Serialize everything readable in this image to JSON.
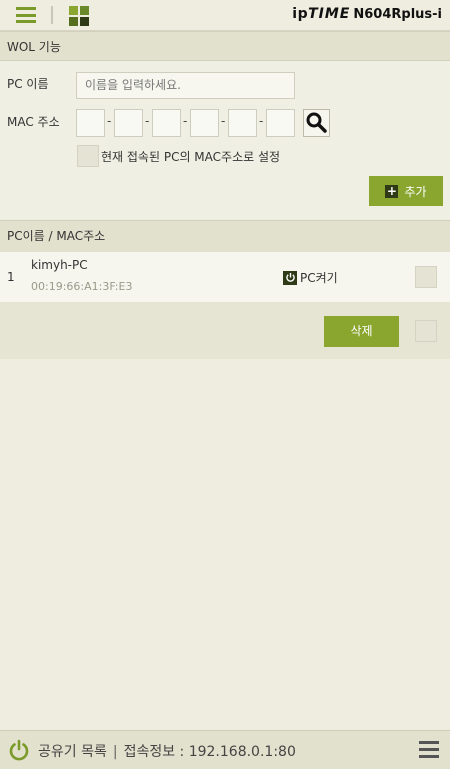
{
  "header": {
    "brand_ip": "ip",
    "brand_time": "TIME",
    "model": "N604Rplus-i"
  },
  "wol_section": {
    "title": "WOL 기능"
  },
  "form": {
    "pc_name_label": "PC 이름",
    "pc_name_placeholder": "이름을 입력하세요.",
    "mac_label": "MAC 주소",
    "mac_fields": [
      "",
      "",
      "",
      "",
      "",
      ""
    ],
    "current_pc_checkbox_label": "현재 접속된 PC의 MAC주소로 설정",
    "add_button": "추가"
  },
  "list_section": {
    "title": "PC이름 / MAC주소",
    "rows": [
      {
        "index": "1",
        "name": "kimyh-PC",
        "mac": "00:19:66:A1:3F:E3",
        "action": "PC켜기"
      }
    ],
    "delete_button": "삭제"
  },
  "footer": {
    "router_list": "공유기 목록",
    "separator": "|",
    "connection_info": "접속정보 : 192.168.0.1:80"
  },
  "colors": {
    "accent": "#8AA62E",
    "background": "#EEEDE0",
    "header": "#E2E1CD"
  }
}
